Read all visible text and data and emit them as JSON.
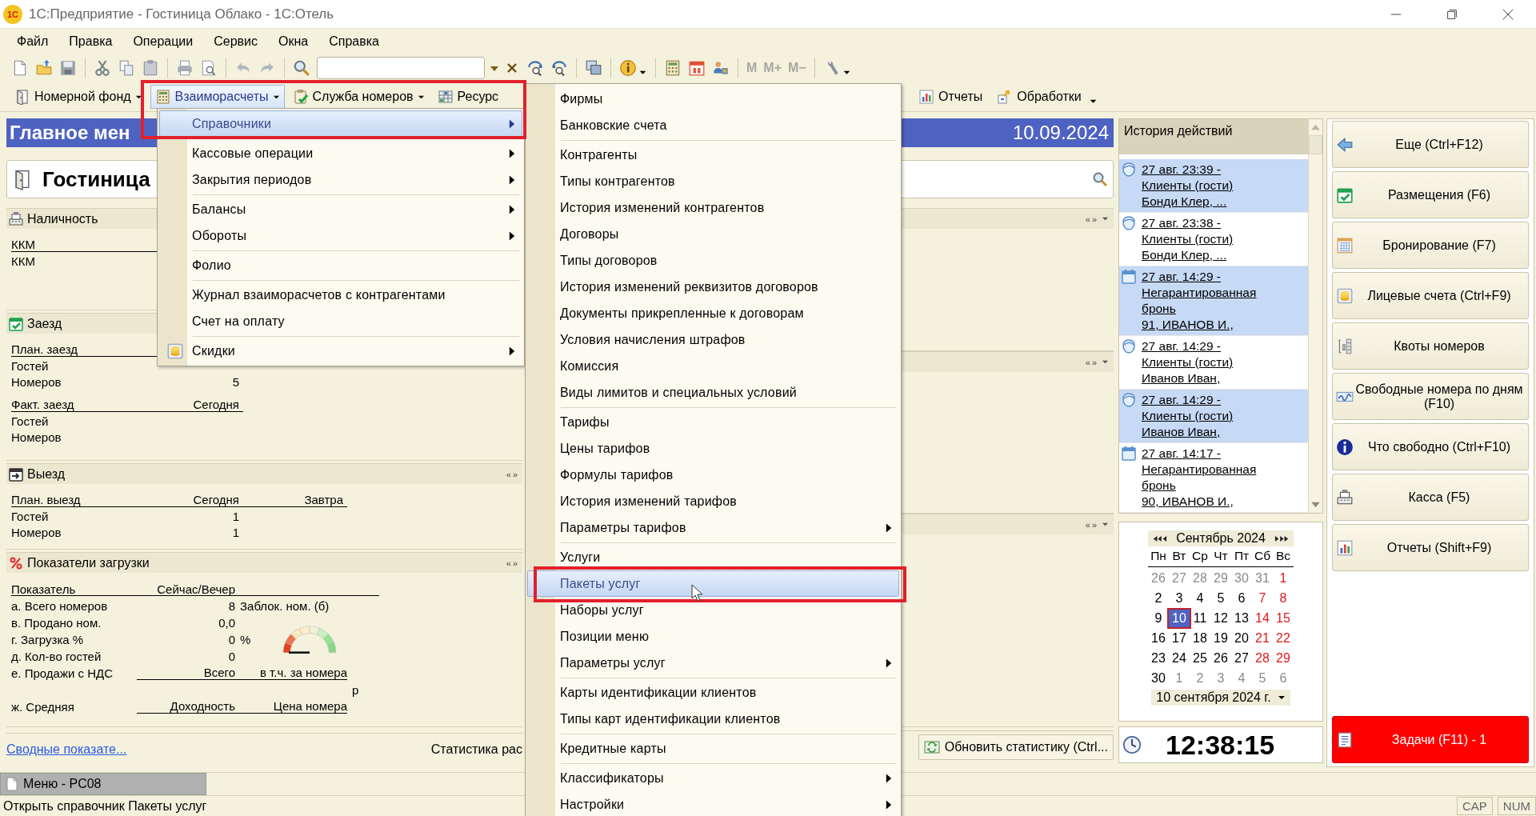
{
  "window": {
    "logo": "1С",
    "title": "1С:Предприятие - Гостиница Облако - 1С:Отель"
  },
  "menubar": [
    "Файл",
    "Правка",
    "Операции",
    "Сервис",
    "Окна",
    "Справка"
  ],
  "toolbar": {
    "memory_buttons": [
      "M",
      "M+",
      "M−"
    ]
  },
  "command_bar": [
    {
      "label": "Номерной фонд",
      "dropdown": true,
      "selected": false
    },
    {
      "label": "Взаиморасчеты",
      "dropdown": true,
      "selected": true
    },
    {
      "label": "Служба номеров",
      "dropdown": true,
      "selected": false
    },
    {
      "label": "Ресурс",
      "dropdown": false,
      "selected": false
    }
  ],
  "command_bar_right": [
    {
      "label": "Отчеты",
      "dropdown": false
    },
    {
      "label": "Обработки",
      "dropdown": true
    }
  ],
  "main_header": {
    "title": "Главное мен",
    "date": "10.09.2024"
  },
  "hotel": "Гостиница",
  "availability": {
    "title": "Наличность",
    "columns": [
      "ККМ"
    ],
    "rows": [
      [
        "ККМ"
      ]
    ]
  },
  "checkin": {
    "title": "Заезд",
    "tables": [
      {
        "columns": [
          "План. заезд"
        ],
        "rows": [
          [
            "Гостей"
          ],
          [
            "Номеров",
            "5"
          ]
        ]
      },
      {
        "columns": [
          "Факт. заезд",
          "Сегодня"
        ],
        "rows": [
          [
            "Гостей"
          ],
          [
            "Номеров"
          ]
        ]
      }
    ]
  },
  "checkout": {
    "title": "Выезд",
    "nav": [
      "«",
      "»"
    ],
    "tables": [
      {
        "columns": [
          "План. выезд",
          "Сегодня",
          "Завтра"
        ],
        "rows": [
          [
            "Гостей",
            "1"
          ],
          [
            "Номеров",
            "1"
          ]
        ]
      }
    ]
  },
  "indicators": {
    "title": "Показатели загрузки",
    "nav": [
      "«",
      "»"
    ],
    "columns": [
      "Показатель",
      "Сейчас/Вечер"
    ],
    "rows": [
      {
        "kind": "value",
        "label": "а. Всего номеров",
        "value": "8",
        "extra": "Заблок. ном. (б)"
      },
      {
        "kind": "value",
        "label": "в. Продано ном.",
        "value": "0,0"
      },
      {
        "kind": "value",
        "label": "г. Загрузка %",
        "value": "0",
        "unit": "%"
      },
      {
        "kind": "value",
        "label": "д. Кол-во гостей",
        "value": "0"
      },
      {
        "kind": "split",
        "label": "е. Продажи с НДС",
        "value": "Всего",
        "extra": "в т.ч. за номера",
        "currency": "р"
      },
      {
        "kind": "split",
        "label": "ж. Средняя",
        "value": "Доходность",
        "extra": "Цена номера"
      }
    ]
  },
  "right_sections": [
    {
      "nav": [
        "«",
        "»"
      ]
    },
    {
      "nav": [
        "«",
        "»"
      ]
    },
    {
      "nav": [
        "«",
        "»"
      ]
    }
  ],
  "summary_link": "Сводные показате...",
  "stats_label": "Статистика рас",
  "refresh_button": "Обновить статистику (Ctrl...",
  "history": {
    "title": "История действий",
    "items": [
      {
        "kind": "guest",
        "selected": true,
        "lines": [
          "27 авг. 23:39 -",
          "Клиенты (гости)",
          "Бонди Клер, ..."
        ]
      },
      {
        "kind": "guest",
        "selected": false,
        "lines": [
          "27 авг. 23:38 -",
          "Клиенты (гости)",
          "Бонди Клер, ..."
        ]
      },
      {
        "kind": "booking",
        "selected": true,
        "lines": [
          "27 авг. 14:29 -",
          "Негарантированная",
          "бронь",
          "91, ИВАНОВ И.,"
        ]
      },
      {
        "kind": "guest",
        "selected": false,
        "lines": [
          "27 авг. 14:29 -",
          "Клиенты (гости)",
          "Иванов Иван,"
        ]
      },
      {
        "kind": "guest",
        "selected": true,
        "lines": [
          "27 авг. 14:29 -",
          "Клиенты (гости)",
          "Иванов Иван,"
        ]
      },
      {
        "kind": "booking",
        "selected": false,
        "lines": [
          "27 авг. 14:17 -",
          "Негарантированная",
          "бронь",
          "90, ИВАНОВ И.,"
        ]
      }
    ]
  },
  "calendar": {
    "month": "Сентябрь 2024",
    "weekdays": [
      "Пн",
      "Вт",
      "Ср",
      "Чт",
      "Пт",
      "Сб",
      "Вс"
    ],
    "weeks": [
      [
        {
          "d": "26",
          "kind": "other",
          "selected": false
        },
        {
          "d": "27",
          "kind": "other",
          "selected": false
        },
        {
          "d": "28",
          "kind": "other",
          "selected": false
        },
        {
          "d": "29",
          "kind": "other",
          "selected": false
        },
        {
          "d": "30",
          "kind": "other",
          "selected": false
        },
        {
          "d": "31",
          "kind": "other",
          "selected": false
        },
        {
          "d": "1",
          "kind": "weekend",
          "selected": false
        }
      ],
      [
        {
          "d": "2",
          "kind": "day",
          "selected": false
        },
        {
          "d": "3",
          "kind": "day",
          "selected": false
        },
        {
          "d": "4",
          "kind": "day",
          "selected": false
        },
        {
          "d": "5",
          "kind": "day",
          "selected": false
        },
        {
          "d": "6",
          "kind": "day",
          "selected": false
        },
        {
          "d": "7",
          "kind": "weekend",
          "selected": false
        },
        {
          "d": "8",
          "kind": "weekend",
          "selected": false
        }
      ],
      [
        {
          "d": "9",
          "kind": "day",
          "selected": false
        },
        {
          "d": "10",
          "kind": "day",
          "selected": true
        },
        {
          "d": "11",
          "kind": "day",
          "selected": false
        },
        {
          "d": "12",
          "kind": "day",
          "selected": false
        },
        {
          "d": "13",
          "kind": "day",
          "selected": false
        },
        {
          "d": "14",
          "kind": "weekend",
          "selected": false
        },
        {
          "d": "15",
          "kind": "weekend",
          "selected": false
        }
      ],
      [
        {
          "d": "16",
          "kind": "day",
          "selected": false
        },
        {
          "d": "17",
          "kind": "day",
          "selected": false
        },
        {
          "d": "18",
          "kind": "day",
          "selected": false
        },
        {
          "d": "19",
          "kind": "day",
          "selected": false
        },
        {
          "d": "20",
          "kind": "day",
          "selected": false
        },
        {
          "d": "21",
          "kind": "weekend",
          "selected": false
        },
        {
          "d": "22",
          "kind": "weekend",
          "selected": false
        }
      ],
      [
        {
          "d": "23",
          "kind": "day",
          "selected": false
        },
        {
          "d": "24",
          "kind": "day",
          "selected": false
        },
        {
          "d": "25",
          "kind": "day",
          "selected": false
        },
        {
          "d": "26",
          "kind": "day",
          "selected": false
        },
        {
          "d": "27",
          "kind": "day",
          "selected": false
        },
        {
          "d": "28",
          "kind": "weekend",
          "selected": false
        },
        {
          "d": "29",
          "kind": "weekend",
          "selected": false
        }
      ],
      [
        {
          "d": "30",
          "kind": "day",
          "selected": false
        },
        {
          "d": "1",
          "kind": "other",
          "selected": false
        },
        {
          "d": "2",
          "kind": "other",
          "selected": false
        },
        {
          "d": "3",
          "kind": "other",
          "selected": false
        },
        {
          "d": "4",
          "kind": "other",
          "selected": false
        },
        {
          "d": "5",
          "kind": "other",
          "selected": false
        },
        {
          "d": "6",
          "kind": "other",
          "selected": false
        }
      ]
    ],
    "date_field": "10 сентября 2024 г."
  },
  "clock": "12:38:15",
  "quick_buttons": [
    "Еще (Ctrl+F12)",
    "Размещения (F6)",
    "Бронирование (F7)",
    "Лицевые счета (Ctrl+F9)",
    "Квоты номеров",
    "Свободные номера по дням (F10)",
    "Что свободно (Ctrl+F10)",
    "Касса (F5)",
    "Отчеты (Shift+F9)"
  ],
  "tasks_button": {
    "label": "Задачи (F11) - 1",
    "alert": true
  },
  "taskbar": [
    {
      "label": "Меню - PC08",
      "selected": true
    }
  ],
  "status_bar": {
    "text": "Открыть справочник Пакеты услуг",
    "indicators": [
      "CAP",
      "NUM"
    ]
  },
  "dropdown": {
    "groups": [
      [
        {
          "label": "Справочники",
          "submenu": true,
          "selected": true
        }
      ],
      [
        {
          "label": "Кассовые операции",
          "submenu": true,
          "selected": false
        },
        {
          "label": "Закрытия периодов",
          "submenu": true,
          "selected": false
        }
      ],
      [
        {
          "label": "Балансы",
          "submenu": true,
          "selected": false
        },
        {
          "label": "Обороты",
          "submenu": true,
          "selected": false
        }
      ],
      [
        {
          "label": "Фолио",
          "submenu": false,
          "selected": false
        }
      ],
      [
        {
          "label": "Журнал взаиморасчетов с контрагентами",
          "submenu": false,
          "selected": false
        },
        {
          "label": "Счет на оплату",
          "submenu": false,
          "selected": false
        }
      ],
      [
        {
          "label": "Скидки",
          "submenu": true,
          "selected": false
        }
      ]
    ]
  },
  "submenu": {
    "groups": [
      [
        {
          "label": "Фирмы",
          "submenu": false,
          "selected": false
        },
        {
          "label": "Банковские счета",
          "submenu": false,
          "selected": false
        }
      ],
      [
        {
          "label": "Контрагенты",
          "submenu": false,
          "selected": false
        },
        {
          "label": "Типы контрагентов",
          "submenu": false,
          "selected": false
        },
        {
          "label": "История изменений контрагентов",
          "submenu": false,
          "selected": false
        },
        {
          "label": "Договоры",
          "submenu": false,
          "selected": false
        },
        {
          "label": "Типы договоров",
          "submenu": false,
          "selected": false
        },
        {
          "label": "История изменений реквизитов договоров",
          "submenu": false,
          "selected": false
        },
        {
          "label": "Документы прикрепленные к договорам",
          "submenu": false,
          "selected": false
        },
        {
          "label": "Условия начисления штрафов",
          "submenu": false,
          "selected": false
        },
        {
          "label": "Комиссия",
          "submenu": false,
          "selected": false
        },
        {
          "label": "Виды лимитов и специальных условий",
          "submenu": false,
          "selected": false
        }
      ],
      [
        {
          "label": "Тарифы",
          "submenu": false,
          "selected": false
        },
        {
          "label": "Цены тарифов",
          "submenu": false,
          "selected": false
        },
        {
          "label": "Формулы тарифов",
          "submenu": false,
          "selected": false
        },
        {
          "label": "История изменений тарифов",
          "submenu": false,
          "selected": false
        },
        {
          "label": "Параметры тарифов",
          "submenu": true,
          "selected": false
        }
      ],
      [
        {
          "label": "Услуги",
          "submenu": false,
          "selected": false
        },
        {
          "label": "Пакеты услуг",
          "submenu": false,
          "selected": true
        },
        {
          "label": "Наборы услуг",
          "submenu": false,
          "selected": false
        },
        {
          "label": "Позиции меню",
          "submenu": false,
          "selected": false
        },
        {
          "label": "Параметры услуг",
          "submenu": true,
          "selected": false
        }
      ],
      [
        {
          "label": "Карты идентификации клиентов",
          "submenu": false,
          "selected": false
        },
        {
          "label": "Типы карт идентификации клиентов",
          "submenu": false,
          "selected": false
        }
      ],
      [
        {
          "label": "Кредитные карты",
          "submenu": false,
          "selected": false
        }
      ],
      [
        {
          "label": "Классификаторы",
          "submenu": true,
          "selected": false
        },
        {
          "label": "Настройки",
          "submenu": true,
          "selected": false
        }
      ]
    ]
  }
}
